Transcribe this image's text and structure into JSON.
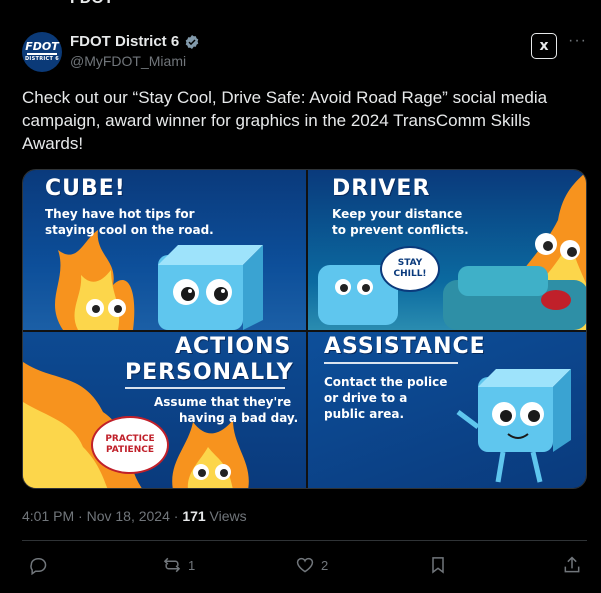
{
  "tweet": {
    "author_name": "FDOT District 6",
    "handle": "@MyFDOT_Miami",
    "avatar_line1": "FDOT",
    "avatar_line2": "DISTRICT 6",
    "text": "Check out our “Stay Cool, Drive Safe: Avoid Road Rage” social media campaign, award winner for graphics in the 2024 TransComm Skills Awards!",
    "time": "4:01 PM · Nov 18, 2024 · ",
    "views_count": "171",
    "views_label": " Views",
    "grok_label": "x",
    "more_label": "···"
  },
  "media": {
    "panels": [
      {
        "title": "CUBE!",
        "subtitle_l1": "They have hot tips for",
        "subtitle_l2": "staying cool on the road."
      },
      {
        "title": "DRIVER",
        "subtitle_l1": "Keep your distance",
        "subtitle_l2": "to prevent conflicts.",
        "bubble_l1": "STAY",
        "bubble_l2": "CHILL!"
      },
      {
        "title_l1": "ACTIONS",
        "title_l2": "PERSONALLY",
        "subtitle_l1": "Assume that they're",
        "subtitle_l2": "having a bad day.",
        "bubble_l1": "PRACTICE",
        "bubble_l2": "PATIENCE"
      },
      {
        "title": "ASSISTANCE",
        "subtitle_l1": "Contact the police",
        "subtitle_l2": "or drive to a",
        "subtitle_l3": "public area."
      }
    ]
  },
  "actions": {
    "reply_count": "",
    "retweet_count": "1",
    "like_count": "2"
  },
  "colors": {
    "background": "#000000",
    "text": "#e7e9ea",
    "muted": "#71767b",
    "verified": "#829aab",
    "panel_blue": "#0a3a7c"
  }
}
